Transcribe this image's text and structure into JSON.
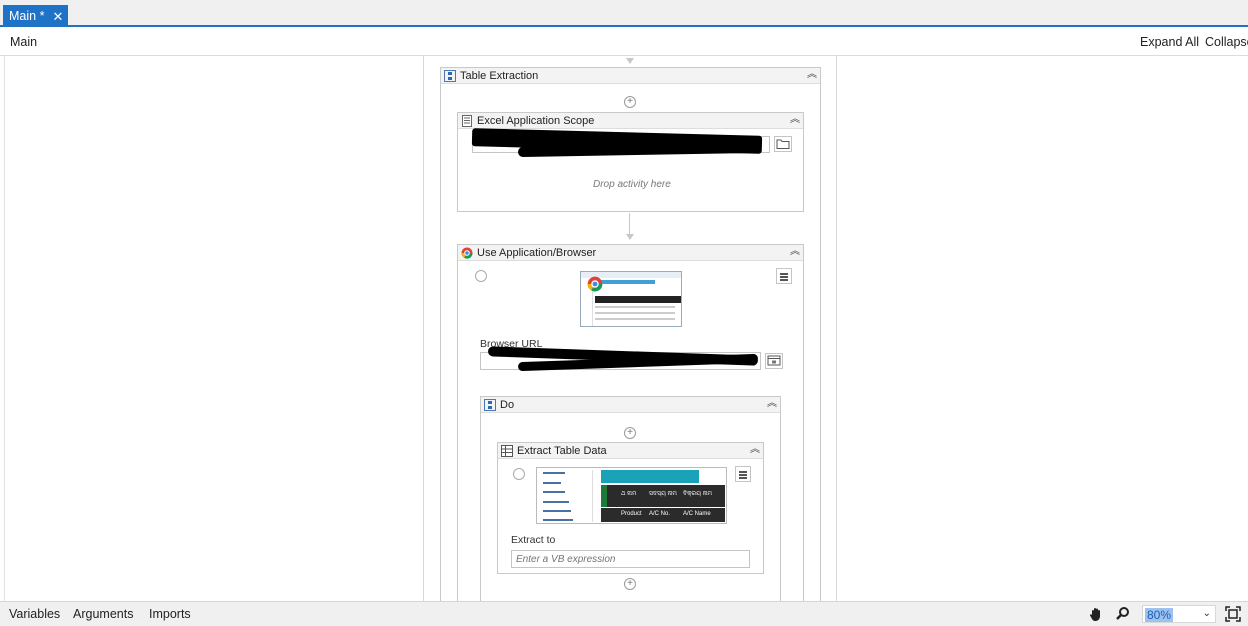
{
  "tab": {
    "title": "Main *",
    "close": "✕"
  },
  "breadcrumb": {
    "current": "Main"
  },
  "toolbar": {
    "expand_all": "Expand All",
    "collapse_all": "Collapse All"
  },
  "workflow": {
    "table_extraction": {
      "title": "Table Extraction",
      "collapse": "︽"
    },
    "excel_scope": {
      "title": "Excel Application Scope",
      "collapse": "︽",
      "drop_hint": "Drop activity here"
    },
    "use_browser": {
      "title": "Use Application/Browser",
      "collapse": "︽",
      "browser_url_label": "Browser URL"
    },
    "do": {
      "title": "Do",
      "collapse": "︽"
    },
    "extract_table": {
      "title": "Extract Table Data",
      "collapse": "︽",
      "extract_to_label": "Extract to",
      "extract_to_placeholder": "Enter a VB expression",
      "preview_header": [
        "ଥ ନାମ",
        "ସଦସ୍ୟ ନାମ",
        "ବିକ୍ରୟ ନାମ"
      ],
      "preview_columns": [
        "Product",
        "A/C No.",
        "A/C Name"
      ]
    }
  },
  "statusbar": {
    "variables": "Variables",
    "arguments": "Arguments",
    "imports": "Imports",
    "zoom": "80%",
    "zoom_caret": "⌄"
  },
  "colors": {
    "accent": "#1e73c6",
    "zoom_highlight": "#9cc3ef"
  }
}
